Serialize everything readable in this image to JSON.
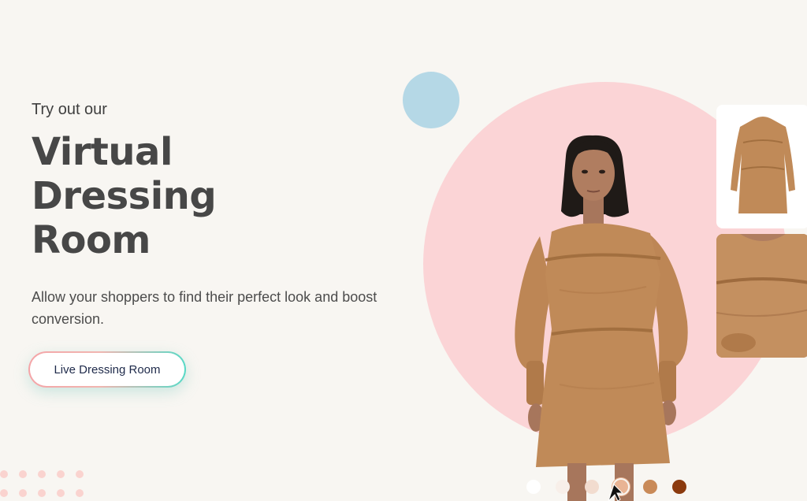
{
  "hero": {
    "eyebrow": "Try out our",
    "headline": [
      "Virtual",
      "Dressing",
      "Room"
    ],
    "subcopy": "Allow your shoppers to find their perfect look and boost conversion.",
    "cta_label": "Live Dressing Room"
  },
  "colors": {
    "background": "#f8f6f2",
    "accent_pink": "#fbd4d6",
    "accent_blue": "#b5d8e6",
    "dress": "#c08a58",
    "cta_gradient_start": "#f4a5a8",
    "cta_gradient_end": "#57d9c6"
  },
  "showcase": {
    "model_image": "model-in-brown-dress",
    "thumbnails": [
      {
        "name": "dress-front-thumbnail",
        "icon": "dress-icon"
      },
      {
        "name": "dress-detail-thumbnail",
        "icon": "fabric-detail-icon"
      }
    ],
    "swatches": [
      "#ffffff",
      "#f8efe9",
      "#f2dccf",
      "#e9b494",
      "#c98a58",
      "#8b3a0e"
    ],
    "selected_swatch": 3
  },
  "icons": {
    "cursor": "mouse-pointer-icon"
  }
}
